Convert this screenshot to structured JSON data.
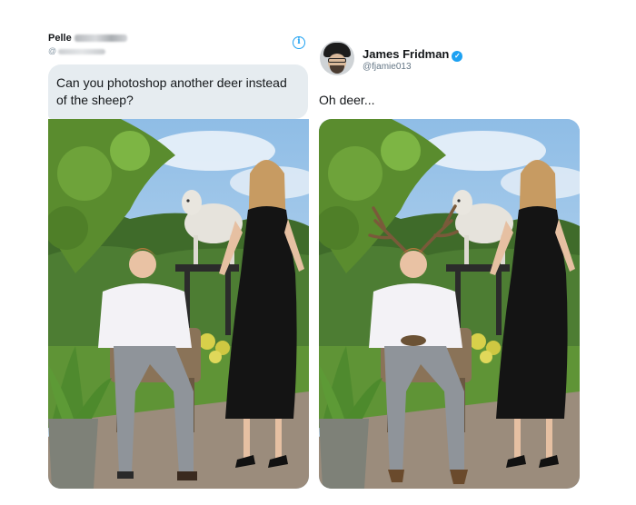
{
  "request_tweet": {
    "author_name": "Pelle",
    "author_handle_prefix": "@",
    "text": "Can you photoshop another deer instead of the sheep?"
  },
  "reply_tweet": {
    "author_name": "James Fridman",
    "author_handle": "@fjamie013",
    "verified": true,
    "text": "Oh deer..."
  },
  "icons": {
    "info": "info-icon",
    "verified": "verified-badge-icon"
  },
  "colors": {
    "twitter_blue": "#1da1f2",
    "bubble_bg": "#e6ecf0",
    "handle_gray": "#657786"
  }
}
